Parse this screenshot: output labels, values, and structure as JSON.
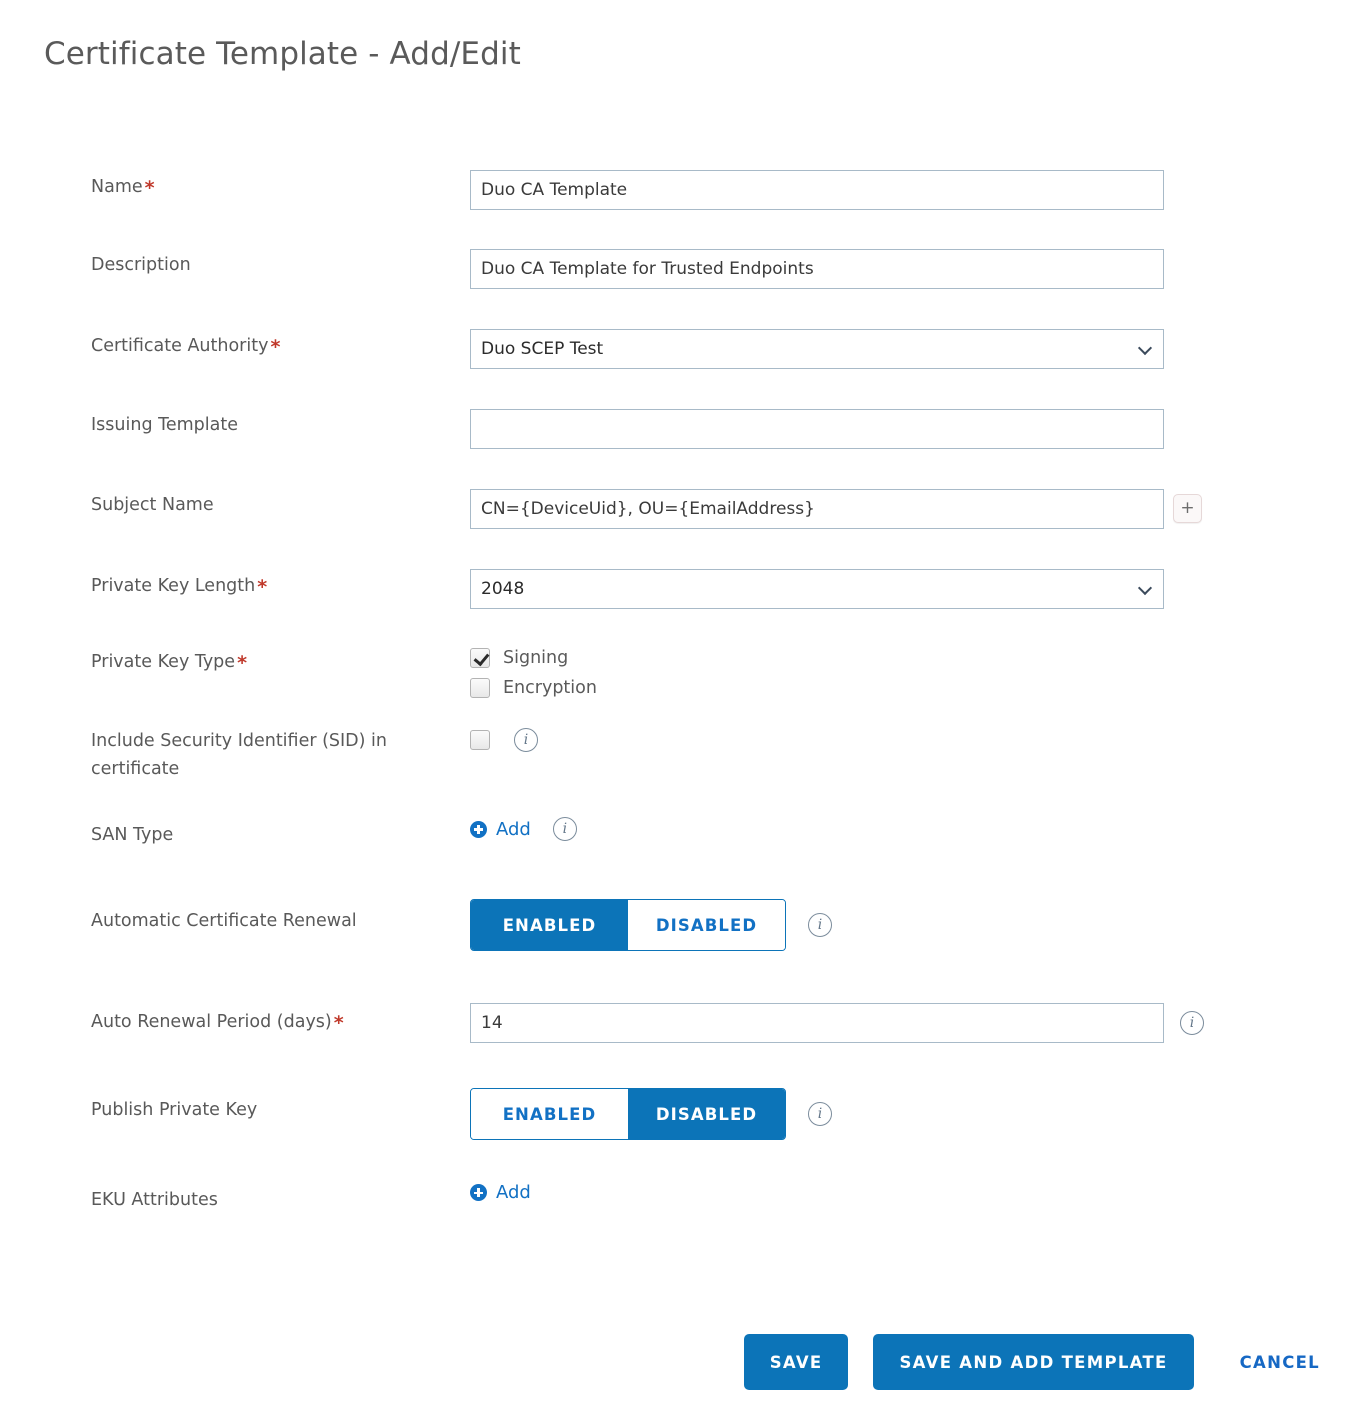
{
  "page": {
    "title": "Certificate Template - Add/Edit",
    "required_marker": "*"
  },
  "fields": {
    "name": {
      "label": "Name",
      "value": "Duo CA Template",
      "placeholder": ""
    },
    "description": {
      "label": "Description",
      "value": "Duo CA Template for Trusted Endpoints",
      "placeholder": ""
    },
    "certificate_authority": {
      "label": "Certificate Authority",
      "value": "Duo SCEP Test"
    },
    "issuing_template": {
      "label": "Issuing Template",
      "value": "",
      "placeholder": ""
    },
    "subject_name": {
      "label": "Subject Name",
      "value": "CN={DeviceUid}, OU={EmailAddress}",
      "placeholder": "",
      "add_button": "+"
    },
    "private_key_length": {
      "label": "Private Key Length",
      "value": "2048"
    },
    "private_key_type": {
      "label": "Private Key Type",
      "options": [
        {
          "label": "Signing",
          "checked": true
        },
        {
          "label": "Encryption",
          "checked": false
        }
      ]
    },
    "include_sid": {
      "label": "Include Security Identifier (SID) in certificate",
      "checked": false,
      "info": "i"
    },
    "san_type": {
      "label": "SAN Type",
      "add_label": "Add",
      "info": "i"
    },
    "automatic_certificate_renewal": {
      "label": "Automatic Certificate Renewal",
      "enabled_label": "ENABLED",
      "disabled_label": "DISABLED",
      "selected": "ENABLED",
      "info": "i"
    },
    "auto_renewal_period": {
      "label": "Auto Renewal Period (days)",
      "value": "14",
      "placeholder": "",
      "info": "i"
    },
    "publish_private_key": {
      "label": "Publish Private Key",
      "enabled_label": "ENABLED",
      "disabled_label": "DISABLED",
      "selected": "DISABLED",
      "info": "i"
    },
    "eku_attributes": {
      "label": "EKU Attributes",
      "add_label": "Add"
    }
  },
  "footer": {
    "save": "SAVE",
    "save_and_add_template": "SAVE AND ADD TEMPLATE",
    "cancel": "CANCEL"
  },
  "colors": {
    "accent_blue": "#0c74b8",
    "link_blue": "#1271c4",
    "cancel_blue": "#1668c4",
    "required_red": "#c0392b",
    "input_border": "#a8bac8",
    "label_text": "#595959"
  }
}
